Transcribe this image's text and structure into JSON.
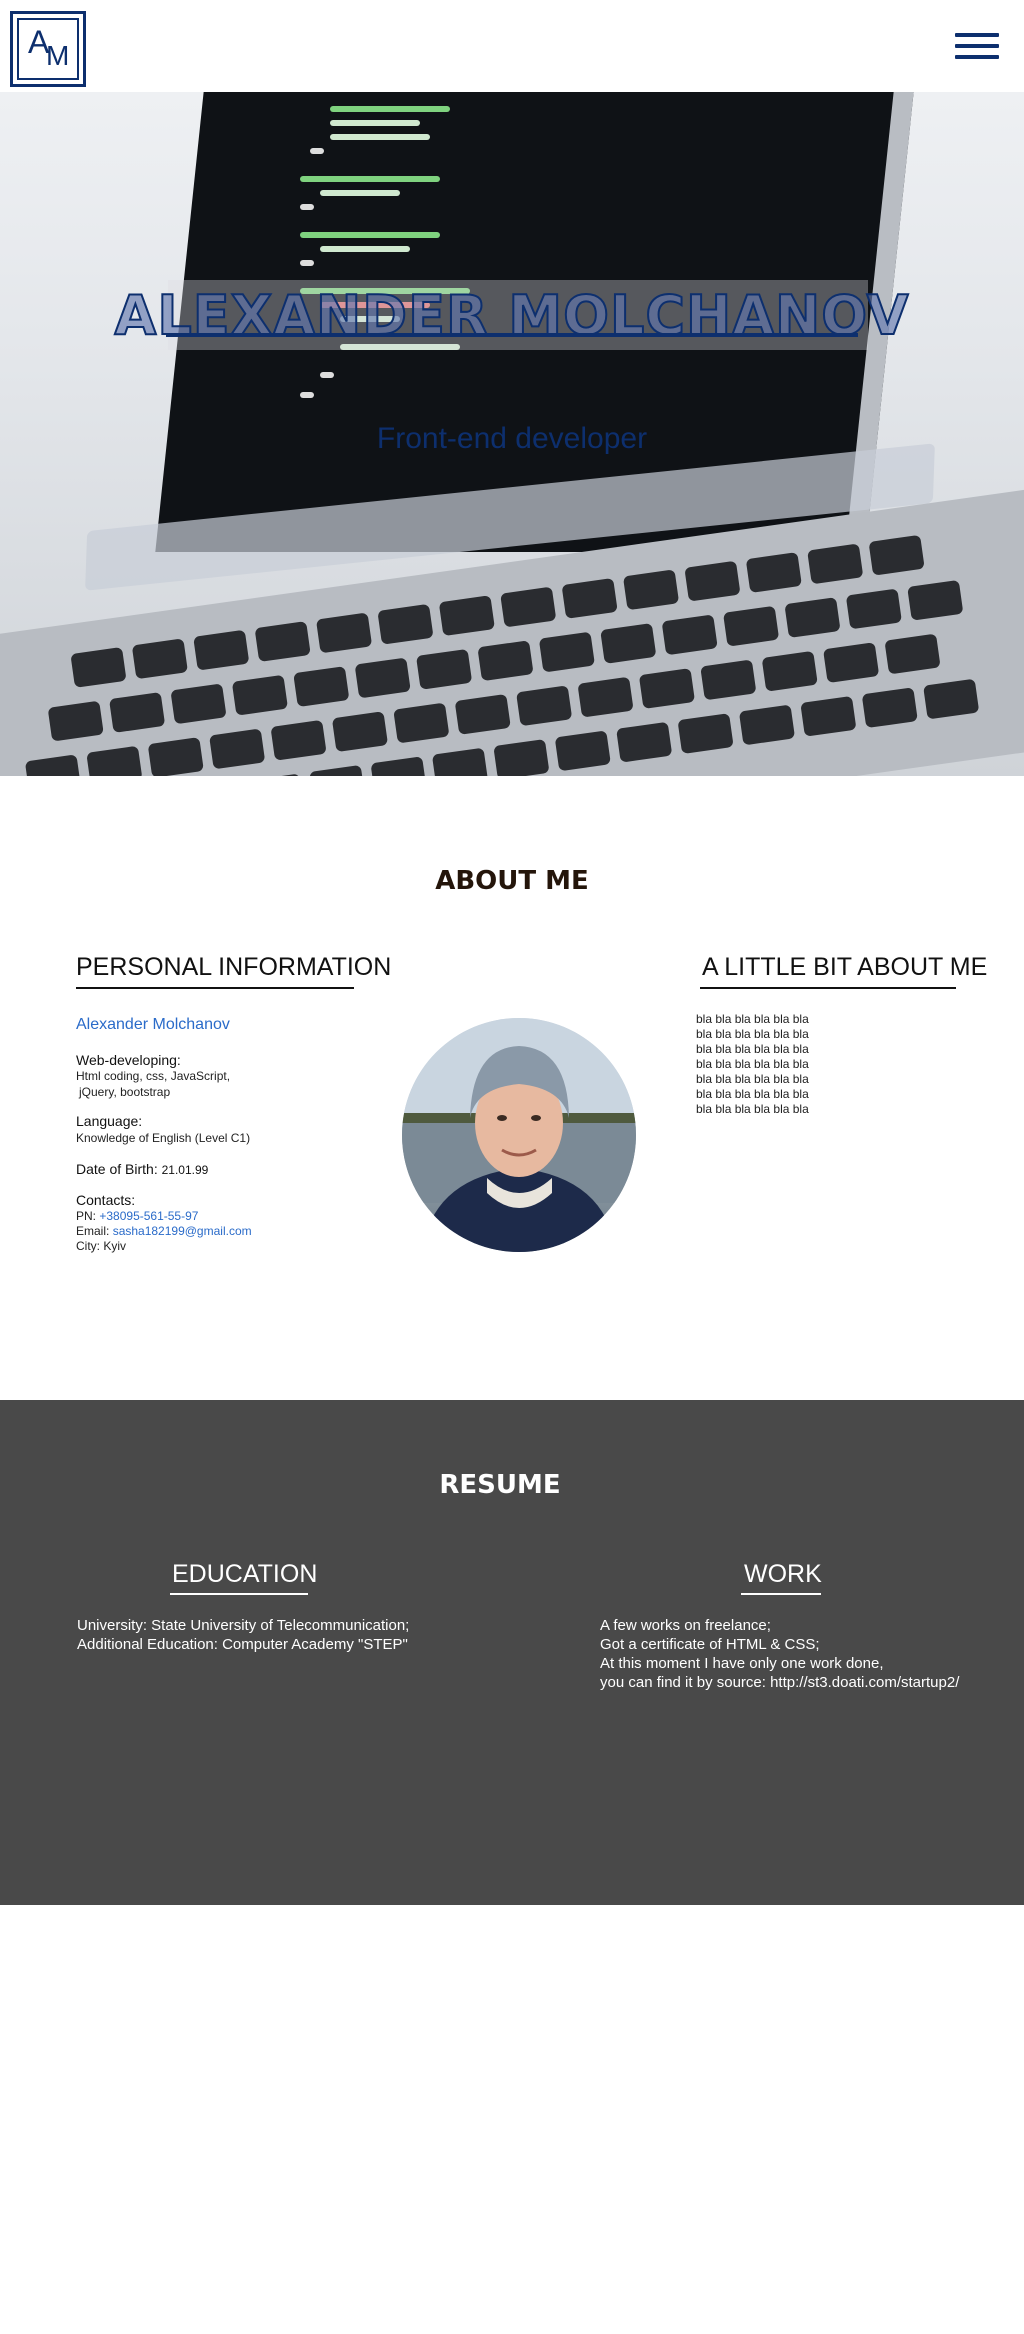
{
  "header": {
    "logo": {
      "letter_a": "A",
      "letter_m": "M"
    },
    "menu_icon": "hamburger-menu-icon"
  },
  "hero": {
    "title": "ALEXANDER MOLCHANOV",
    "subtitle": "Front-end developer"
  },
  "about": {
    "title": "ABOUT ME",
    "personal": {
      "heading": "PERSONAL INFORMATION",
      "name": "Alexander Molchanov",
      "web_label": "Web-developing:",
      "web_text_1": "Html coding, css, JavaScript,",
      "web_text_2": "jQuery, bootstrap",
      "language_label": "Language:",
      "language_text": "Knowledge of English (Level C1)",
      "dob_label": "Date of Birth:",
      "dob_value": "21.01.99",
      "contacts_label": "Contacts:",
      "pn_label": "PN:",
      "pn_value": "+38095-561-55-97",
      "email_label": "Email:",
      "email_value": "sasha182199@gmail.com",
      "city_label": "City:",
      "city_value": "Kyiv"
    },
    "little": {
      "heading": "A LITTLE BIT ABOUT ME",
      "lines": [
        "bla bla bla bla bla bla",
        "bla bla bla bla bla bla",
        "bla bla bla bla bla bla",
        "bla bla bla bla bla bla",
        "bla bla bla bla bla bla",
        "bla bla bla bla bla bla",
        "bla bla bla bla bla bla"
      ]
    }
  },
  "resume": {
    "title": "RESUME",
    "education": {
      "heading": "EDUCATION",
      "text": "University: State University of Telecommunication;\nAdditional Education: Computer Academy \"STEP\""
    },
    "work": {
      "heading": "WORK",
      "text": "A few works on freelance;\nGot a certificate of HTML & CSS;\nAt this moment I have only one work done,\nyou can find it by source: http://st3.doati.com/startup2/"
    }
  },
  "colors": {
    "brand": "#0d2f6e",
    "link": "#2a6bc9",
    "resume_bg": "#494949"
  }
}
